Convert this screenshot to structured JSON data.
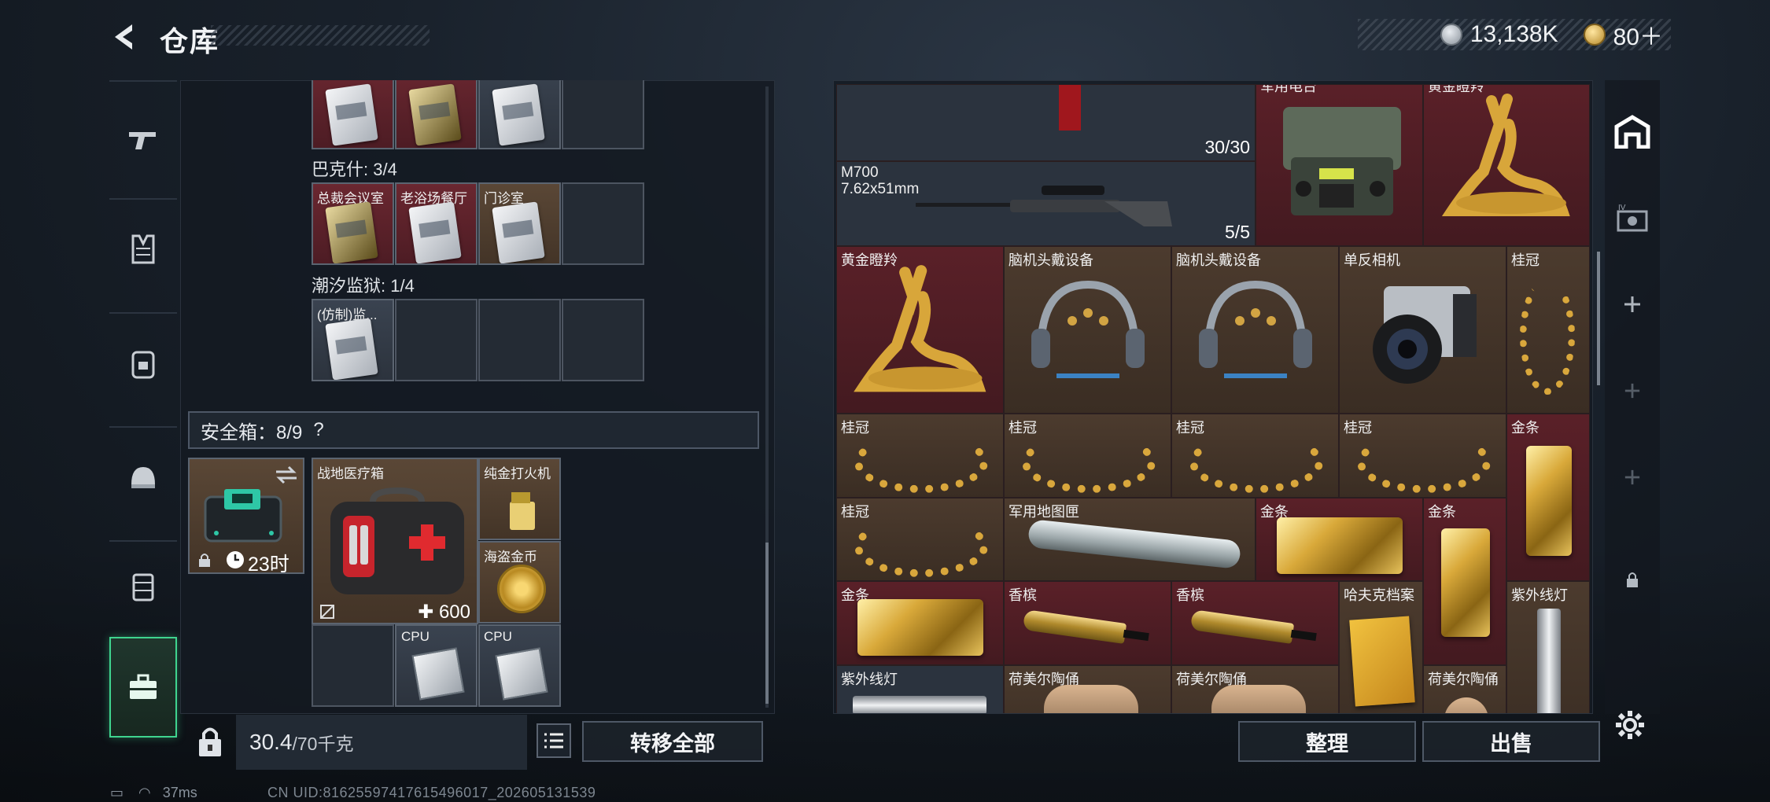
{
  "header": {
    "title": "仓库",
    "currency": [
      {
        "icon": "silver-coin-icon",
        "value": "13,138K"
      },
      {
        "icon": "gold-coin-icon",
        "value": "80＋"
      }
    ]
  },
  "nav": {
    "items": [
      {
        "name": "weapon",
        "icon": "gun-icon"
      },
      {
        "name": "armor",
        "icon": "vest-icon"
      },
      {
        "name": "backpack",
        "icon": "backpack-icon"
      },
      {
        "name": "helmet",
        "icon": "helmet-icon"
      },
      {
        "name": "rig",
        "icon": "rig-icon"
      },
      {
        "name": "case",
        "icon": "briefcase-icon",
        "active": true
      }
    ]
  },
  "left": {
    "keys_top": [
      {
        "color": "red",
        "kind": "silver"
      },
      {
        "color": "red",
        "kind": "gold"
      },
      {
        "color": "gray",
        "kind": "silver"
      },
      {
        "color": "empty"
      }
    ],
    "sections": [
      {
        "title": "巴克什: 3/4",
        "slots": [
          {
            "label": "总裁会议室",
            "color": "red",
            "kind": "gold"
          },
          {
            "label": "老浴场餐厅",
            "color": "red",
            "kind": "silver"
          },
          {
            "label": "门诊室",
            "color": "brown",
            "kind": "silver"
          },
          {
            "label": "",
            "color": "empty"
          }
        ]
      },
      {
        "title": "潮汐监狱: 1/4",
        "slots": [
          {
            "label": "(仿制)监...",
            "color": "gray",
            "kind": "silver"
          },
          {
            "label": "",
            "color": "empty"
          },
          {
            "label": "",
            "color": "empty"
          },
          {
            "label": "",
            "color": "empty"
          }
        ]
      }
    ],
    "safe_box": {
      "label": "安全箱：8/9",
      "help": "?",
      "timer": "23时"
    },
    "safe_items": {
      "medkit": {
        "label": "战地医疗箱",
        "value": "600"
      },
      "lighter": "纯金打火机",
      "pirate_coin": "海盗金币",
      "cpu1": "CPU",
      "cpu2": "CPU"
    },
    "weight": {
      "current": "30.4",
      "max": "/70千克"
    },
    "transfer_all": "转移全部"
  },
  "right": {
    "items": {
      "radio": "军用电台",
      "deer_top": "黄金瞪羚",
      "m700_name": "M700",
      "m700_ammo": "7.62x51mm",
      "m700_count": "5/5",
      "ammo_count": "30/30",
      "deer": "黄金瞪羚",
      "headset1": "脑机头戴设备",
      "headset2": "脑机头戴设备",
      "camera": "单反相机",
      "laurel": "桂冠",
      "laurel_r2a": "桂冠",
      "laurel_r2b": "桂冠",
      "laurel_r2c": "桂冠",
      "laurel_r2d": "桂冠",
      "goldbar_r2": "金条",
      "laurel_r3": "桂冠",
      "map_tube": "军用地图匣",
      "goldbar_r3a": "金条",
      "goldbar_r3b": "金条",
      "goldbar_r4": "金条",
      "champagne1": "香槟",
      "champagne2": "香槟",
      "hafuk": "哈夫克档案",
      "uv_lamp": "紫外线灯",
      "uv_lamp2": "紫外线灯",
      "figurine1": "荷美尔陶俑",
      "figurine2": "荷美尔陶俑",
      "figurine3": "荷美尔陶俑"
    },
    "sort": "整理",
    "sell": "出售"
  },
  "status": {
    "ping": "37ms",
    "uid": "CN UID:8162559741761549601​7_202605131539"
  },
  "colors": {
    "accent": "#3fd48f",
    "red_slot": "#5a2028",
    "brown_slot": "#4c3b2e"
  }
}
